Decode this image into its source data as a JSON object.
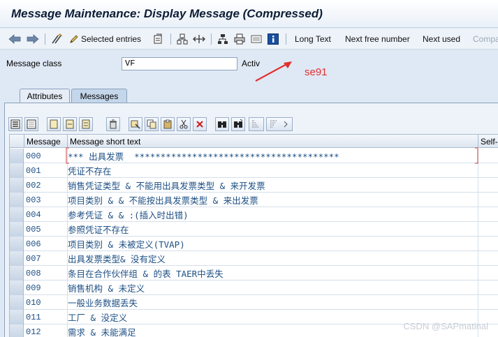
{
  "window": {
    "title": "Message Maintenance: Display Message (Compressed)"
  },
  "toolbar": {
    "icons": [
      "back-arrow-icon",
      "forward-arrow-icon",
      "display-change-icon",
      "pencil-icon",
      "where-used-icon",
      "hierarchy-icon",
      "navigate-icon",
      "org-structure-icon",
      "printer-icon",
      "screen-icon",
      "info-icon"
    ],
    "selected_entries_label": "Selected entries",
    "long_text_label": "Long Text",
    "next_free_number_label": "Next free number",
    "next_used_label": "Next used",
    "compare_label": "Compa"
  },
  "header": {
    "message_class_label": "Message class",
    "message_class_value": "VF",
    "status": "Activ"
  },
  "annotation": {
    "text": "se91",
    "color": "#e03030"
  },
  "tabs": [
    {
      "label": "Attributes",
      "active": false
    },
    {
      "label": "Messages",
      "active": true
    }
  ],
  "table": {
    "headers": {
      "number": "Message",
      "text": "Message short text",
      "self": "Self-e"
    },
    "rows": [
      {
        "number": "000",
        "text": "*** 出具发票  ***************************************"
      },
      {
        "number": "001",
        "text": "凭证不存在"
      },
      {
        "number": "002",
        "text": "销售凭证类型 & 不能用出具发票类型 & 来开发票"
      },
      {
        "number": "003",
        "text": "项目类别 & & 不能按出具发票类型 & 来出发票"
      },
      {
        "number": "004",
        "text": "参考凭证 & & :(插入时出错)"
      },
      {
        "number": "005",
        "text": "参照凭证不存在"
      },
      {
        "number": "006",
        "text": "项目类别 & 未被定义(TVAP)"
      },
      {
        "number": "007",
        "text": "出具发票类型& 没有定义"
      },
      {
        "number": "008",
        "text": "条目在合作伙伴组 & 的表 TAER中丢失"
      },
      {
        "number": "009",
        "text": "销售机构 & 未定义"
      },
      {
        "number": "010",
        "text": "一般业务数据丢失"
      },
      {
        "number": "011",
        "text": "工厂 & 没定义"
      },
      {
        "number": "012",
        "text": "需求 & 未能满足"
      }
    ]
  },
  "watermark": "CSDN @SAPmatinal",
  "colors": {
    "accent": "#1d4f84",
    "background": "#dfe9f5"
  }
}
